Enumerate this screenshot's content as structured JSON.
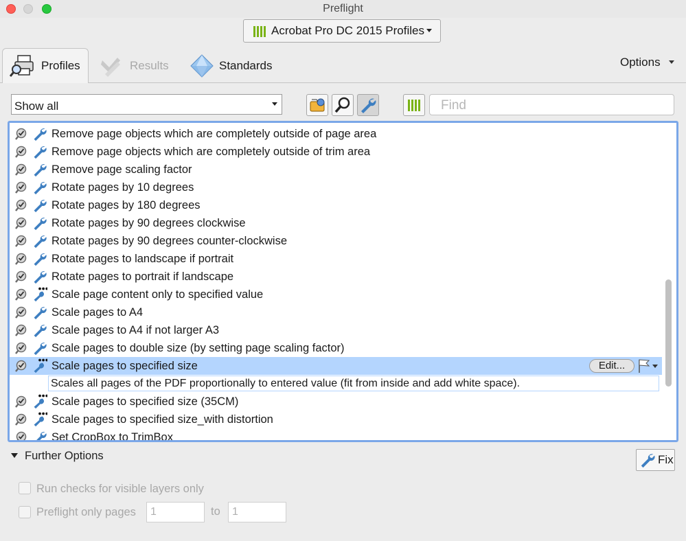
{
  "window": {
    "title": "Preflight"
  },
  "profile_selector": {
    "label": "Acrobat Pro DC 2015 Profiles"
  },
  "tabs": [
    {
      "label": "Profiles",
      "active": true
    },
    {
      "label": "Results",
      "enabled": false
    },
    {
      "label": "Standards"
    }
  ],
  "options_menu": {
    "label": "Options"
  },
  "filter": {
    "value": "Show all"
  },
  "toolbar": {
    "find_placeholder": "Find"
  },
  "list": {
    "rows": [
      {
        "label": "Remove page objects which are completely outside of page area",
        "icon": "wrench-icon"
      },
      {
        "label": "Remove page objects which are completely outside of trim area",
        "icon": "wrench-icon"
      },
      {
        "label": "Remove page scaling factor",
        "icon": "wrench-icon"
      },
      {
        "label": "Rotate pages by 10 degrees",
        "icon": "wrench-icon"
      },
      {
        "label": "Rotate pages by 180 degrees",
        "icon": "wrench-icon"
      },
      {
        "label": "Rotate pages by 90 degrees clockwise",
        "icon": "wrench-icon"
      },
      {
        "label": "Rotate pages by 90 degrees counter-clockwise",
        "icon": "wrench-icon"
      },
      {
        "label": "Rotate pages to landscape if portrait",
        "icon": "wrench-icon"
      },
      {
        "label": "Rotate pages to portrait if landscape",
        "icon": "wrench-icon"
      },
      {
        "label": "Scale page content only to specified value",
        "icon": "wrench-dots-icon"
      },
      {
        "label": "Scale pages to A4",
        "icon": "wrench-icon"
      },
      {
        "label": "Scale pages to A4 if not larger A3",
        "icon": "wrench-icon"
      },
      {
        "label": "Scale pages to double size (by setting page scaling factor)",
        "icon": "wrench-icon"
      },
      {
        "label": "Scale pages to specified size",
        "icon": "wrench-dots-icon",
        "selected": true
      },
      {
        "label": "Scale pages to specified size (35CM)",
        "icon": "wrench-dots-icon"
      },
      {
        "label": "Scale pages to specified size_with distortion",
        "icon": "wrench-dots-icon"
      },
      {
        "label": "Set CropBox to TrimBox",
        "icon": "wrench-icon"
      }
    ],
    "selected_description": "Scales all pages of the PDF proportionally to entered value (fit from inside and add white space).",
    "edit_label": "Edit..."
  },
  "further_options": {
    "label": "Further Options",
    "fix_label": "Fix",
    "visible_layers_label": "Run checks for visible layers only",
    "pages_label": "Preflight only pages",
    "from_page": "1",
    "to_label": "to",
    "to_page": "1"
  },
  "colors": {
    "accent": "#7aa7e8",
    "selection": "#b4d5fe",
    "library_green": "#7ab317",
    "wrench_blue": "#3e7fc1"
  }
}
